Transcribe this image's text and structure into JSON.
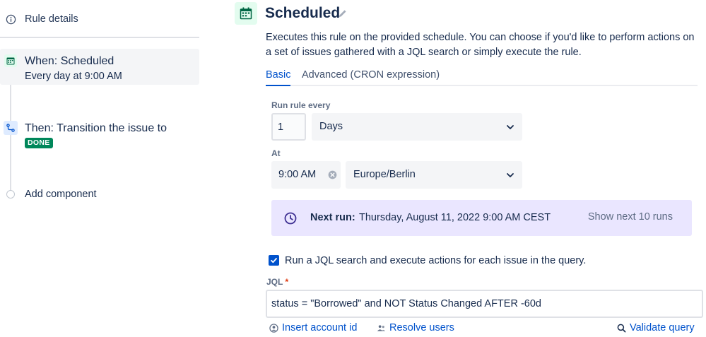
{
  "sidebar": {
    "rule_details": "Rule details",
    "trigger": {
      "title": "When: Scheduled",
      "subtitle": "Every day at 9:00 AM"
    },
    "action": {
      "title": "Then: Transition the issue to",
      "status_lozenge": "DONE"
    },
    "add_component": "Add component"
  },
  "header": {
    "title": "Scheduled",
    "description": "Executes this rule on the provided schedule. You can choose if you'd like to perform actions on a set of issues gathered with a JQL search or simply execute the rule."
  },
  "tabs": [
    {
      "label": "Basic",
      "active": true
    },
    {
      "label": "Advanced (CRON expression)",
      "active": false
    }
  ],
  "form": {
    "run_every_label": "Run rule every",
    "run_every_value": "1",
    "interval_unit": "Days",
    "at_label": "At",
    "time_value": "9:00 AM",
    "timezone": "Europe/Berlin"
  },
  "next_run": {
    "label": "Next run:",
    "value": "Thursday, August 11, 2022 9:00 AM CEST",
    "show_next": "Show next 10 runs"
  },
  "jql": {
    "checkbox_label": "Run a JQL search and execute actions for each issue in the query.",
    "checked": true,
    "label": "JQL",
    "required_marker": "*",
    "query": "status = \"Borrowed\" and NOT Status Changed AFTER -60d",
    "links": {
      "insert_account_id": "Insert account id",
      "resolve_users": "Resolve users",
      "validate_query": "Validate query"
    }
  },
  "colors": {
    "primary": "#0052cc",
    "done_lozenge": "#00875a",
    "next_run_bg": "#eae6ff",
    "trigger_icon_bg": "#e3fcef"
  },
  "icons": [
    "info-icon",
    "calendar-icon",
    "branch-icon",
    "edit-pencil-icon",
    "chevron-down-icon",
    "clear-icon",
    "clock-icon",
    "check-icon",
    "person-icon",
    "people-icon",
    "search-icon"
  ]
}
